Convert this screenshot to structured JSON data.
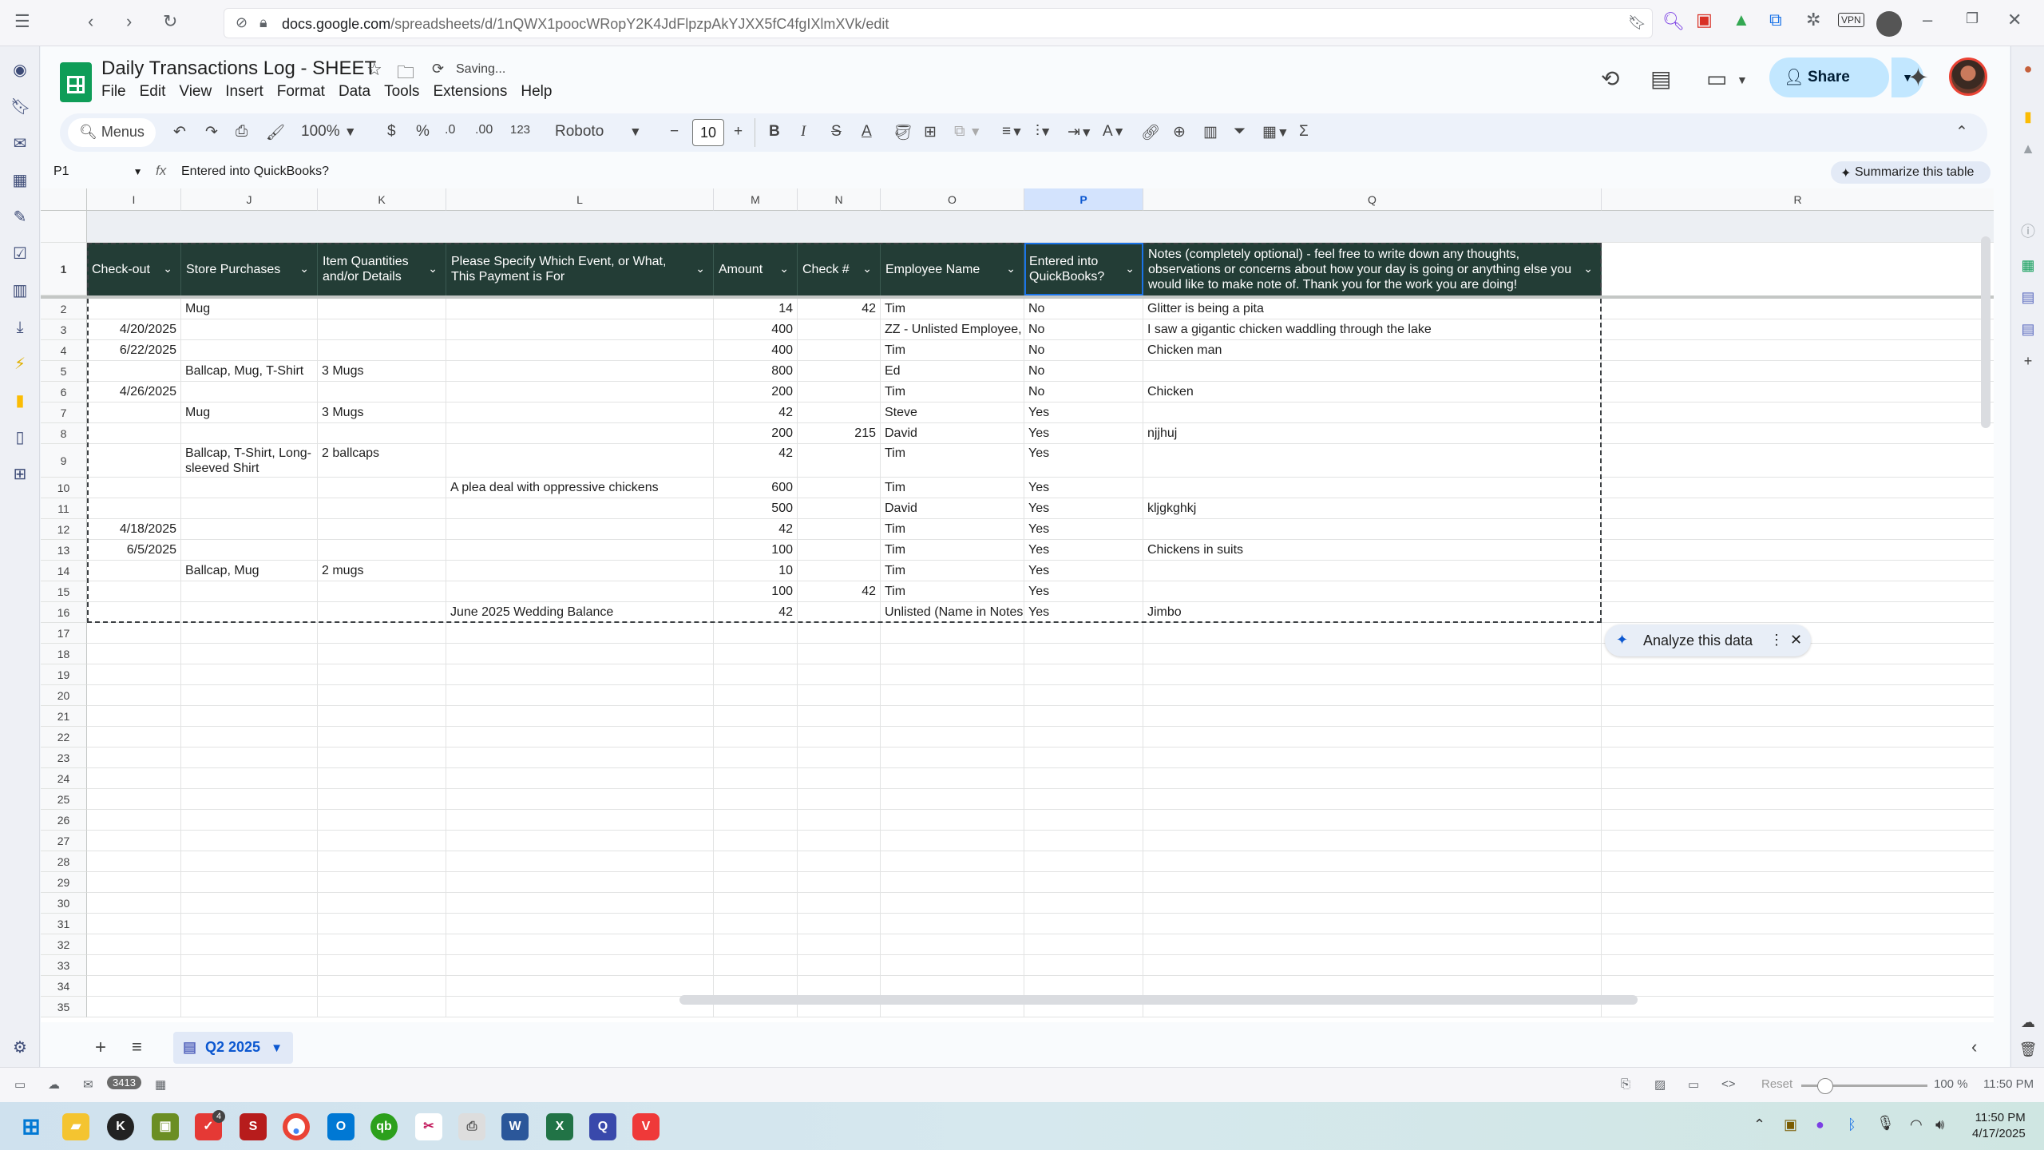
{
  "browser": {
    "url_domain": "docs.google.com",
    "url_path": "/spreadsheets/d/1nQWX1poocWRopY2K4JdFlpzpAkYJXX5fC4fgIXlmXVk/edit"
  },
  "doc": {
    "title": "Daily Transactions Log - SHEET",
    "saving_status": "Saving...",
    "menus": [
      "File",
      "Edit",
      "View",
      "Insert",
      "Format",
      "Data",
      "Tools",
      "Extensions",
      "Help"
    ],
    "share_label": "Share"
  },
  "toolbar": {
    "search_label": "Menus",
    "zoom": "100%",
    "currency": "$",
    "percent": "%",
    "dec_decrease": ".0",
    "dec_increase": ".00",
    "number_format": "123",
    "font": "Roboto",
    "font_size": "10",
    "bold": "B",
    "italic": "I",
    "strike": "S",
    "text_color": "A",
    "sigma": "Σ"
  },
  "formula_bar": {
    "cell_ref": "P1",
    "fx": "fx",
    "value": "Entered into QuickBooks?",
    "summarize_label": "Summarize this table"
  },
  "columns": [
    {
      "letter": "I",
      "w": 118
    },
    {
      "letter": "J",
      "w": 171
    },
    {
      "letter": "K",
      "w": 161
    },
    {
      "letter": "L",
      "w": 335
    },
    {
      "letter": "M",
      "w": 105
    },
    {
      "letter": "N",
      "w": 104
    },
    {
      "letter": "O",
      "w": 180
    },
    {
      "letter": "P",
      "w": 149
    },
    {
      "letter": "Q",
      "w": 574
    },
    {
      "letter": "R",
      "w": 492
    }
  ],
  "header_row": {
    "row_number": "1",
    "labels": [
      "Check-out",
      "Store Purchases",
      "Item Quantities and/or Details",
      "Please Specify Which Event, or What, This Payment is For",
      "Amount",
      "Check #",
      "Employee Name",
      "Entered into QuickBooks?",
      "Notes (completely optional) - feel free to write down any thoughts, observations or concerns about how your day is going or anything else you would like to make note of. Thank you for the work you are doing!"
    ]
  },
  "rows": [
    {
      "n": "2",
      "cells": [
        "",
        "Mug",
        "",
        "",
        "14",
        "42",
        "Tim",
        "No",
        "Glitter is being a pita"
      ]
    },
    {
      "n": "3",
      "cells": [
        "4/20/2025",
        "",
        "",
        "",
        "400",
        "",
        "ZZ - Unlisted Employee,",
        "No",
        "I saw a gigantic chicken waddling through the lake"
      ]
    },
    {
      "n": "4",
      "cells": [
        "6/22/2025",
        "",
        "",
        "",
        "400",
        "",
        "Tim",
        "No",
        "Chicken man"
      ]
    },
    {
      "n": "5",
      "cells": [
        "",
        "Ballcap, Mug, T-Shirt",
        "3 Mugs",
        "",
        "800",
        "",
        "Ed",
        "No",
        ""
      ]
    },
    {
      "n": "6",
      "cells": [
        "4/26/2025",
        "",
        "",
        "",
        "200",
        "",
        "Tim",
        "No",
        "Chicken"
      ]
    },
    {
      "n": "7",
      "cells": [
        "",
        "Mug",
        "3 Mugs",
        "",
        "42",
        "",
        "Steve",
        "Yes",
        ""
      ]
    },
    {
      "n": "8",
      "cells": [
        "",
        "",
        "",
        "",
        "200",
        "215",
        "David",
        "Yes",
        "njjhuj"
      ]
    },
    {
      "n": "9",
      "cells": [
        "",
        "Ballcap, T-Shirt, Long-sleeved Shirt",
        "2 ballcaps",
        "",
        "42",
        "",
        "Tim",
        "Yes",
        ""
      ]
    },
    {
      "n": "10",
      "cells": [
        "",
        "",
        "",
        "A plea deal with oppressive chickens",
        "600",
        "",
        "Tim",
        "Yes",
        ""
      ]
    },
    {
      "n": "11",
      "cells": [
        "",
        "",
        "",
        "",
        "500",
        "",
        "David",
        "Yes",
        "kljgkghkj"
      ]
    },
    {
      "n": "12",
      "cells": [
        "4/18/2025",
        "",
        "",
        "",
        "42",
        "",
        "Tim",
        "Yes",
        ""
      ]
    },
    {
      "n": "13",
      "cells": [
        "6/5/2025",
        "",
        "",
        "",
        "100",
        "",
        "Tim",
        "Yes",
        "Chickens in suits"
      ]
    },
    {
      "n": "14",
      "cells": [
        "",
        "Ballcap, Mug",
        "2 mugs",
        "",
        "10",
        "",
        "Tim",
        "Yes",
        ""
      ]
    },
    {
      "n": "15",
      "cells": [
        "",
        "",
        "",
        "",
        "100",
        "42",
        "Tim",
        "Yes",
        ""
      ]
    },
    {
      "n": "16",
      "cells": [
        "",
        "",
        "",
        "June 2025 Wedding Balance",
        "42",
        "",
        "Unlisted (Name in Notes",
        "Yes",
        "Jimbo"
      ]
    }
  ],
  "empty_rows": [
    "17",
    "18",
    "19",
    "20",
    "21",
    "22",
    "23",
    "24",
    "25",
    "26",
    "27",
    "28",
    "29",
    "30",
    "31",
    "32",
    "33",
    "34",
    "35"
  ],
  "analyze_chip": "Analyze this data",
  "sheet_tab": "Q2 2025",
  "statusbar": {
    "mail_count": "3413",
    "reset": "Reset",
    "zoom": "100 %",
    "time": "11:50 PM"
  },
  "taskbar": {
    "time": "11:50 PM",
    "date": "4/17/2025",
    "chrome_badge": "4"
  },
  "colors": {
    "header_bg": "#233d36",
    "accent": "#0b57d0",
    "share_bg": "#c2e7ff"
  }
}
